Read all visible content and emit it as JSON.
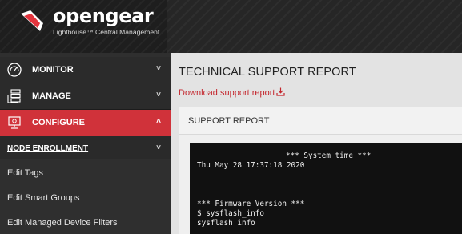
{
  "brand": {
    "name": "opengear",
    "subtitle": "Lighthouse™ Central Management"
  },
  "sidebar": {
    "items": [
      {
        "label": "MONITOR",
        "icon": "gauge-icon",
        "chevron": "˅"
      },
      {
        "label": "MANAGE",
        "icon": "server-stack-icon",
        "chevron": "˅"
      },
      {
        "label": "CONFIGURE",
        "icon": "monitor-settings-icon",
        "chevron": "˄",
        "active": true
      }
    ],
    "subsection": {
      "label": "NODE ENROLLMENT",
      "chevron": "˅"
    },
    "subitems": [
      {
        "label": "Edit Tags"
      },
      {
        "label": "Edit Smart Groups"
      },
      {
        "label": "Edit Managed Device Filters"
      }
    ]
  },
  "main": {
    "title": "TECHNICAL SUPPORT REPORT",
    "download_label": "Download support report",
    "panel_title": "SUPPORT REPORT",
    "terminal_lines": [
      "*** System time ***",
      "Thu May 28 17:37:18 2020",
      "*** Firmware Version ***",
      "$ sysflash_info",
      "sysflash info"
    ]
  },
  "colors": {
    "accent": "#d0323a",
    "link": "#c4252c",
    "sidebar_bg": "#2b2b2b",
    "terminal_bg": "#111111"
  }
}
